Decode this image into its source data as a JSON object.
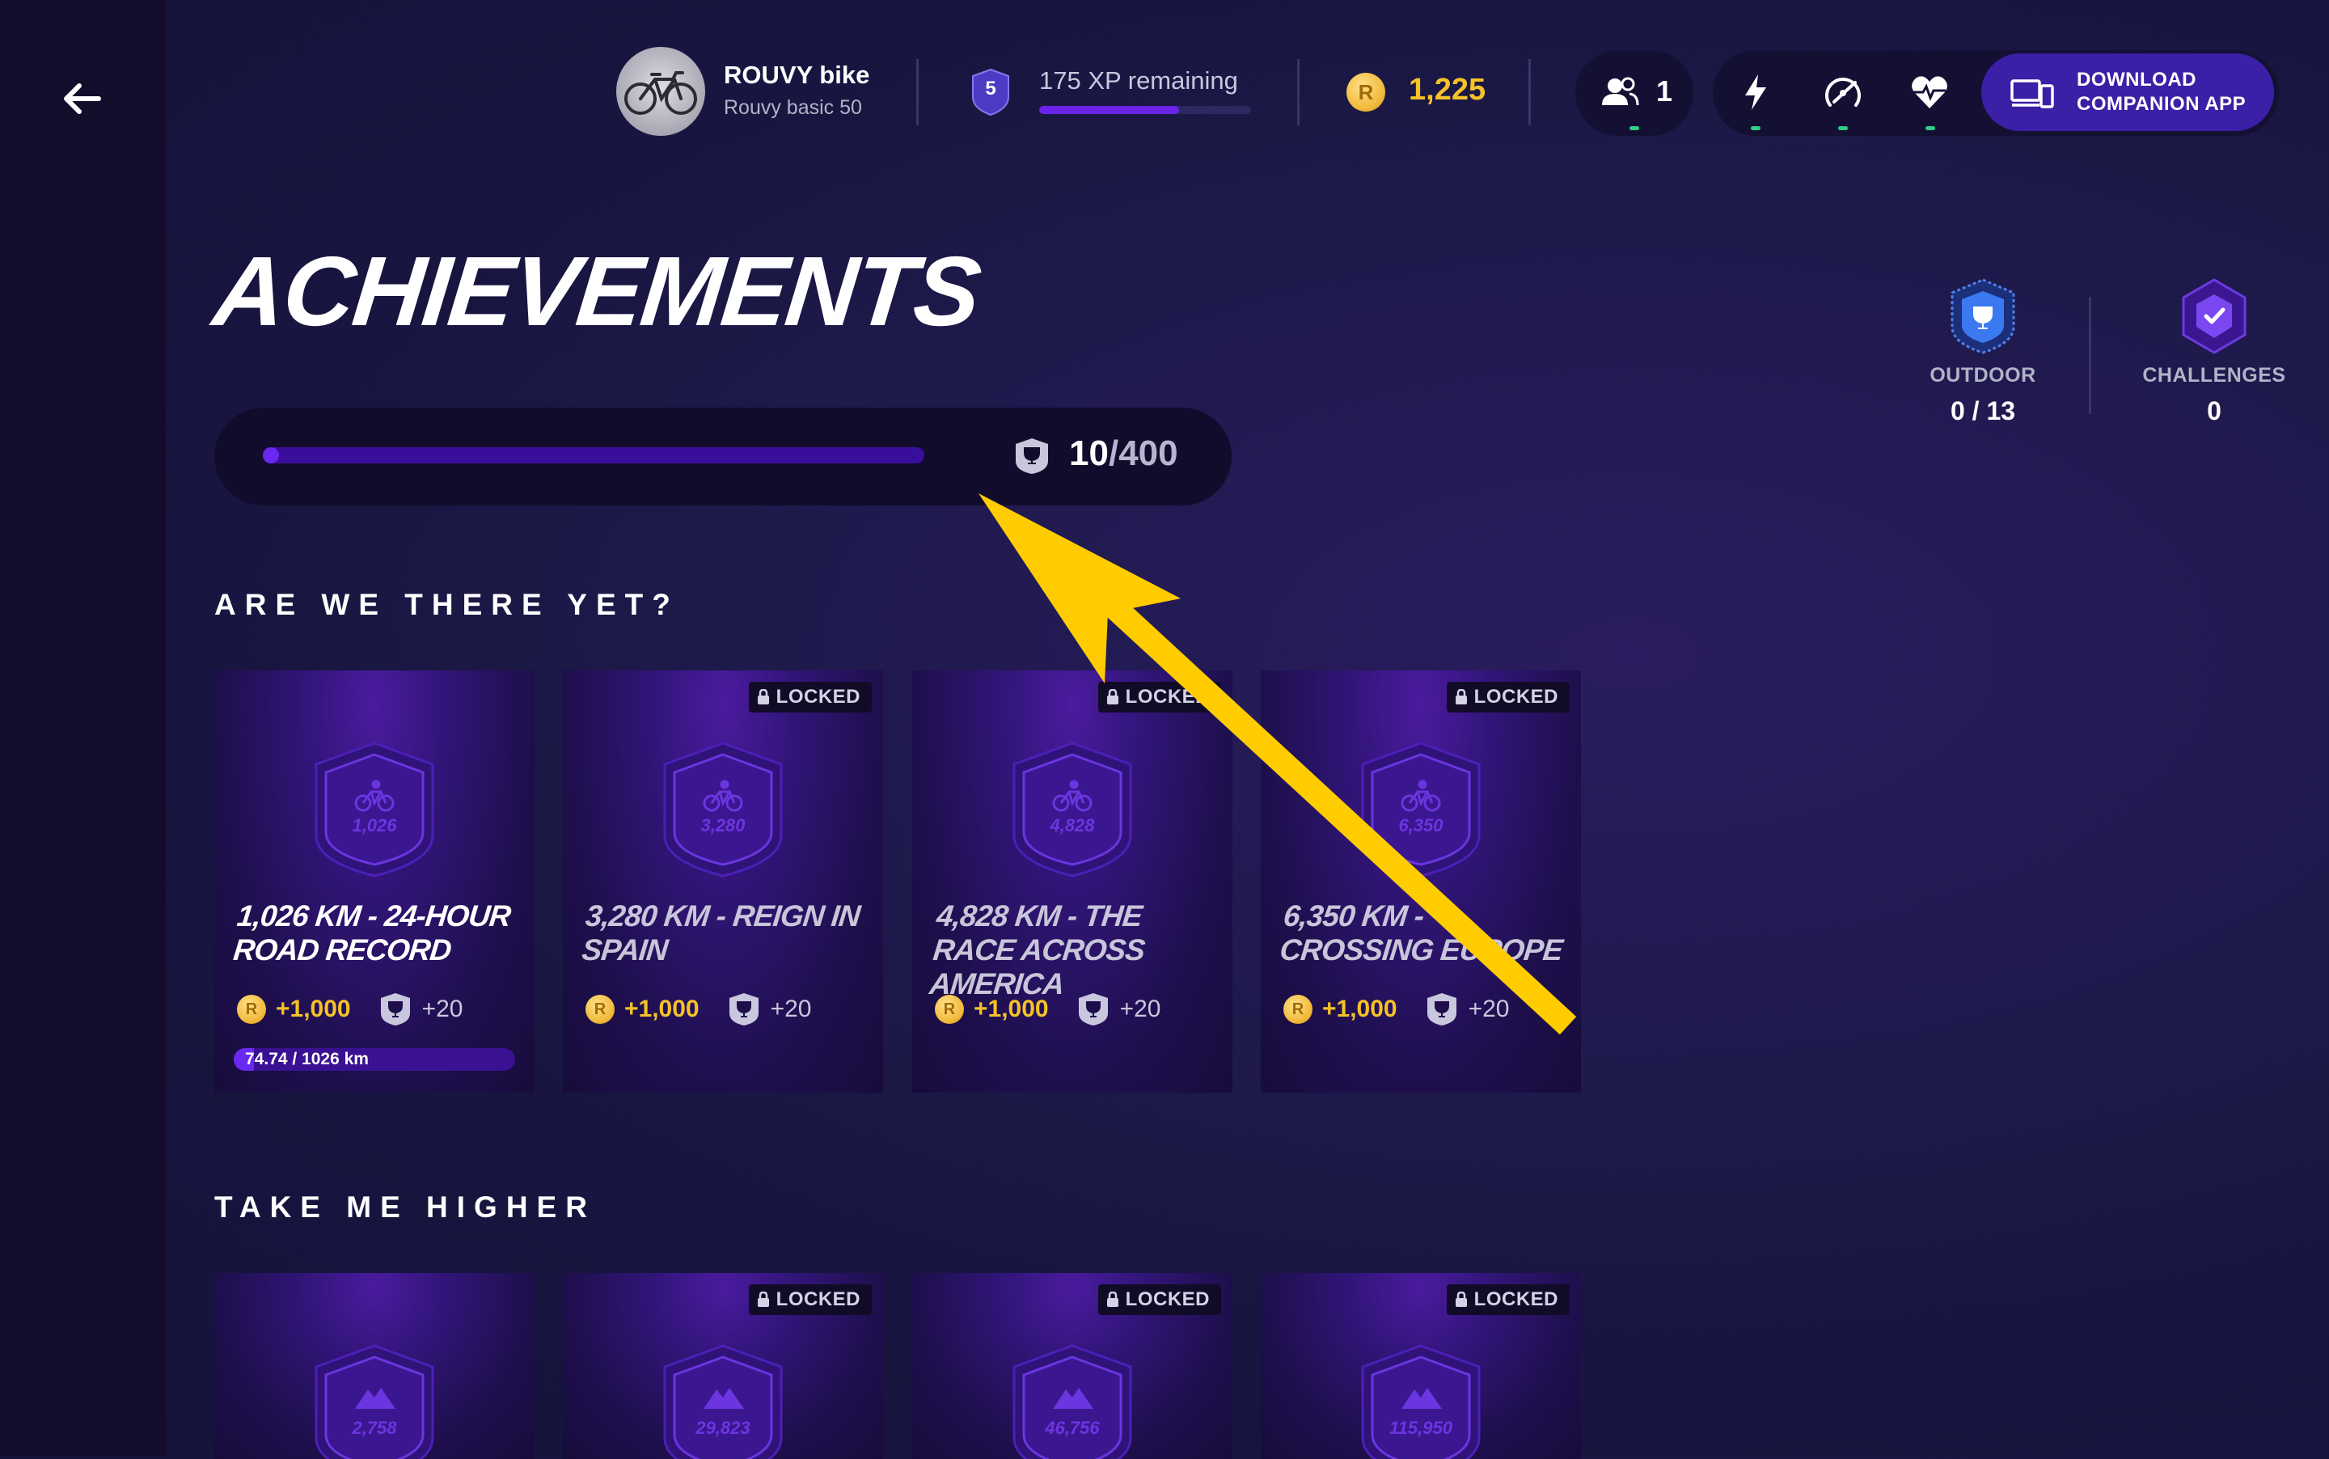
{
  "colors": {
    "background": "#1a1745",
    "accent_purple": "#6b28f0",
    "coin_gold": "#f5c227",
    "status_green": "#2dcf83",
    "annotation_arrow": "#ffcc00"
  },
  "header": {
    "back_icon": "arrow-left-icon",
    "bike": {
      "name": "ROUVY bike",
      "subtitle": "Rouvy basic 50"
    },
    "level": {
      "value": "5",
      "xp_text": "175 XP remaining",
      "xp_progress_fraction": 0.66
    },
    "coins": {
      "symbol": "R",
      "amount": "1,225"
    },
    "friends": {
      "icon": "users-icon",
      "count": "1"
    },
    "sensors": [
      {
        "icon": "power-bolt-icon",
        "connected": true
      },
      {
        "icon": "cadence-gauge-icon",
        "connected": true
      },
      {
        "icon": "heart-rate-icon",
        "connected": true
      }
    ],
    "download_button": {
      "icon": "devices-icon",
      "line1": "DOWNLOAD",
      "line2": "COMPANION APP"
    }
  },
  "page": {
    "title": "ACHIEVEMENTS",
    "progress": {
      "current": "10",
      "separator": "/",
      "total": "400",
      "fraction": 0.025
    }
  },
  "stats": [
    {
      "label": "OUTDOOR",
      "value": "0 / 13",
      "icon": "outdoor-trophy-icon"
    },
    {
      "label": "CHALLENGES",
      "value": "0",
      "icon": "challenges-check-icon"
    }
  ],
  "locked_label": "LOCKED",
  "sections": [
    {
      "title": "ARE WE THERE YET?",
      "badge_icon": "bicycle-icon",
      "cards": [
        {
          "badge_number": "1,026",
          "title": "1,026 KM - 24-HOUR ROAD RECORD",
          "locked": false,
          "coins": "+1,000",
          "trophies": "+20",
          "progress_text": "74.74 / 1026 km",
          "progress_fraction": 0.0728
        },
        {
          "badge_number": "3,280",
          "title": "3,280 KM - REIGN IN SPAIN",
          "locked": true,
          "coins": "+1,000",
          "trophies": "+20"
        },
        {
          "badge_number": "4,828",
          "title": "4,828 KM - THE RACE ACROSS AMERICA",
          "locked": true,
          "coins": "+1,000",
          "trophies": "+20"
        },
        {
          "badge_number": "6,350",
          "title": "6,350 KM - CROSSING EUROPE",
          "locked": true,
          "coins": "+1,000",
          "trophies": "+20"
        }
      ]
    },
    {
      "title": "TAKE ME HIGHER",
      "badge_icon": "mountain-icon",
      "cards": [
        {
          "badge_number": "2,758",
          "locked": false
        },
        {
          "badge_number": "29,823",
          "locked": true
        },
        {
          "badge_number": "46,756",
          "locked": true
        },
        {
          "badge_number": "115,950",
          "locked": true
        }
      ]
    }
  ]
}
